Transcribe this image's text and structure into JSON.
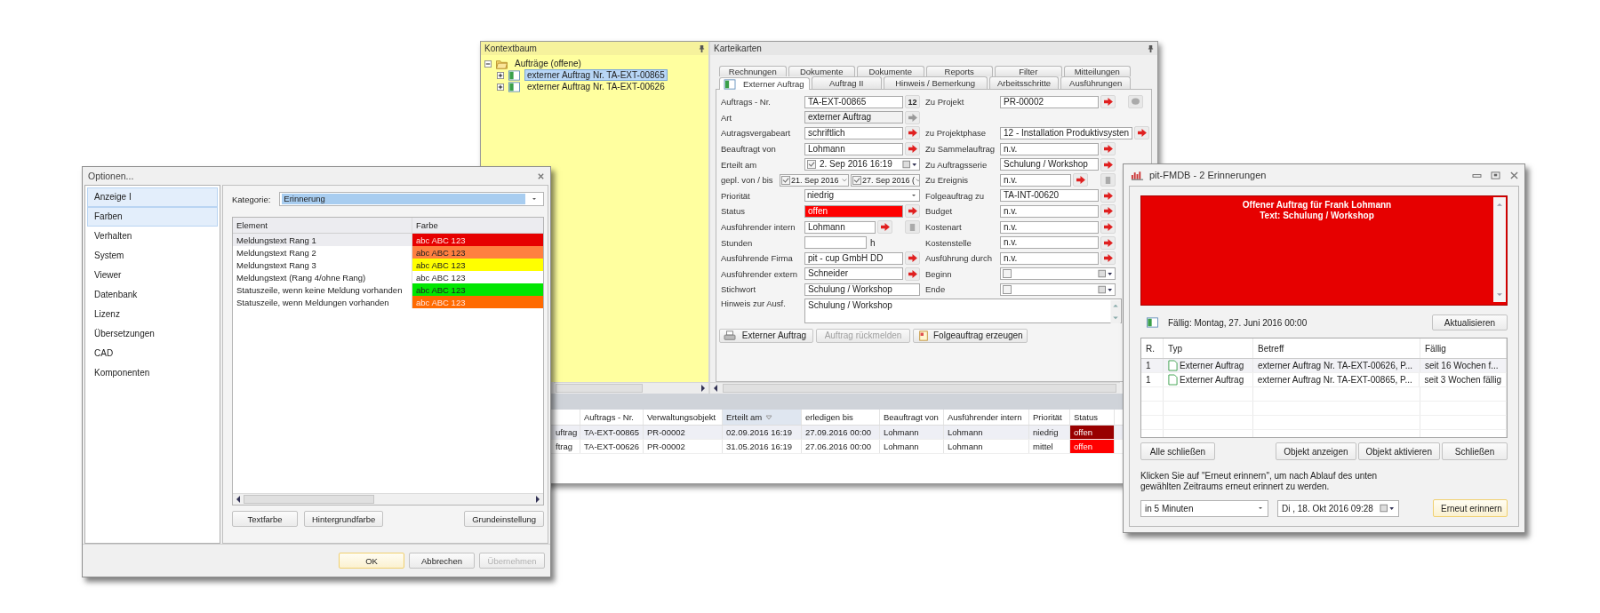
{
  "main_window": {
    "context_tree": {
      "title": "Kontextbaum",
      "items": [
        {
          "label": "Aufträge (offene)",
          "expanded": true,
          "children": [
            {
              "label": "externer Auftrag Nr. TA-EXT-00865",
              "selected": true,
              "expanded": false
            },
            {
              "label": "externer Auftrag Nr. TA-EXT-00626",
              "selected": false,
              "expanded": false
            }
          ]
        }
      ]
    },
    "cards": {
      "title": "Karteikarten",
      "tab_rows": [
        [
          {
            "label": "Rechnungen",
            "selected": false
          },
          {
            "label": "Dokumente",
            "selected": false
          },
          {
            "label": "Dokumente",
            "selected": false
          },
          {
            "label": "Reports",
            "selected": false
          },
          {
            "label": "Filter",
            "selected": false
          },
          {
            "label": "Mitteilungen",
            "selected": false
          }
        ],
        [
          {
            "label": "Externer Auftrag",
            "selected": true
          },
          {
            "label": "Auftrag II",
            "selected": false
          },
          {
            "label": "Hinweis / Bemerkung",
            "selected": false
          },
          {
            "label": "Arbeitsschritte",
            "selected": false
          },
          {
            "label": "Ausführungen",
            "selected": false
          }
        ]
      ],
      "fields_left": [
        {
          "label": "Auftrags - Nr.",
          "kind": "code",
          "value": "TA-EXT-00865",
          "button": "12"
        },
        {
          "label": "Art",
          "kind": "readonly",
          "value": "externer Auftrag"
        },
        {
          "label": "Autragsvergabeart",
          "kind": "lookup",
          "value": "schriftlich"
        },
        {
          "label": "Beauftragt von",
          "kind": "lookup",
          "value": "Lohmann"
        },
        {
          "label": "Erteilt am",
          "kind": "date",
          "checked": true,
          "value": "2. Sep 2016 16:19"
        },
        {
          "label": "gepl. von / bis",
          "kind": "range",
          "from": {
            "checked": true,
            "value": "21. Sep 2016"
          },
          "to": {
            "checked": true,
            "value": "27. Sep 2016 ("
          }
        },
        {
          "label": "Priorität",
          "kind": "combo",
          "value": "niedrig"
        },
        {
          "label": "Status",
          "kind": "lookup",
          "value": "offen",
          "color": "#ff0000"
        },
        {
          "label": "Ausführender intern",
          "kind": "lookup_extra",
          "value": "Lohmann"
        },
        {
          "label": "Stunden",
          "kind": "hours",
          "unit": "h"
        },
        {
          "label": "Ausführende Firma",
          "kind": "lookup",
          "value": "pit - cup GmbH DD"
        },
        {
          "label": "Ausführender extern",
          "kind": "lookup",
          "value": "Schneider"
        },
        {
          "label": "Stichwort",
          "kind": "text",
          "value": "Schulung / Workshop"
        }
      ],
      "fields_right": [
        {
          "label": "Zu  Projekt",
          "kind": "project",
          "value": "PR-00002"
        },
        {
          "label": "zu Projektphase",
          "kind": "lookup",
          "value": "12 - Installation Produktivsysten"
        },
        {
          "label": "Zu Sammelauftrag",
          "kind": "lookup",
          "value": "n.v."
        },
        {
          "label": "Zu Auftragsserie",
          "kind": "lookup",
          "value": "Schulung / Workshop"
        },
        {
          "label": "Zu Ereignis",
          "kind": "lookup_extra",
          "value": "n.v."
        },
        {
          "label": "Folgeauftrag zu",
          "kind": "lookup",
          "value": "TA-INT-00620"
        },
        {
          "label": "Budget",
          "kind": "lookup",
          "value": "n.v."
        },
        {
          "label": "Kostenart",
          "kind": "lookup",
          "value": "n.v."
        },
        {
          "label": "Kostenstelle",
          "kind": "lookup",
          "value": "n.v."
        },
        {
          "label": "Ausführung durch",
          "kind": "lookup",
          "value": "n.v."
        },
        {
          "label": "Beginn",
          "kind": "date",
          "checked": false
        },
        {
          "label": "Ende",
          "kind": "date",
          "checked": false
        }
      ],
      "memo": {
        "label": "Hinweis zur Ausf.",
        "value": "Schulung / Workshop"
      },
      "actions": [
        {
          "label": "Externer Auftrag",
          "disabled": false
        },
        {
          "label": "Auftrag rückmelden",
          "disabled": true
        },
        {
          "label": "Folgeauftrag erzeugen",
          "disabled": false
        }
      ]
    },
    "grid": {
      "columns": [
        {
          "label": "Auftrags - Nr.",
          "sorted": false
        },
        {
          "label": "Verwaltungsobjekt",
          "sorted": false
        },
        {
          "label": "Erteilt am",
          "sorted": true
        },
        {
          "label": "erledigen bis",
          "sorted": false
        },
        {
          "label": "Beauftragt von",
          "sorted": false
        },
        {
          "label": "Ausführender intern",
          "sorted": false
        },
        {
          "label": "Priorität",
          "sorted": false
        },
        {
          "label": "Status",
          "sorted": false
        }
      ],
      "rows": [
        {
          "column_1": "uftrag",
          "cells": [
            "TA-EXT-00865",
            "PR-00002",
            "02.09.2016 16:19",
            "27.09.2016 00:00",
            "Lohmann",
            "Lohmann",
            "niedrig",
            "offen"
          ],
          "color": "#990000",
          "selected": true
        },
        {
          "column_1": "ftrag",
          "cells": [
            "TA-EXT-00626",
            "PR-00002",
            "31.05.2016 16:19",
            "27.06.2016 00:00",
            "Lohmann",
            "Lohmann",
            "mittel",
            "offen"
          ],
          "color": "#ff0000",
          "selected": false
        }
      ]
    }
  },
  "options_window": {
    "title": "Optionen...",
    "nav": [
      {
        "label": "Anzeige I",
        "selected": true
      },
      {
        "label": "Farben",
        "selected": true
      },
      {
        "label": "Verhalten",
        "selected": false
      },
      {
        "label": "System",
        "selected": false
      },
      {
        "label": "Viewer",
        "selected": false
      },
      {
        "label": "Datenbank",
        "selected": false
      },
      {
        "label": "Lizenz",
        "selected": false
      },
      {
        "label": "Übersetzungen",
        "selected": false
      },
      {
        "label": "CAD",
        "selected": false
      },
      {
        "label": "Komponenten",
        "selected": false
      }
    ],
    "category": {
      "label": "Kategorie:",
      "value": "Erinnerung"
    },
    "columns": [
      "Element",
      "Farbe"
    ],
    "rows": [
      {
        "element": "Meldungstext Rang 1",
        "sample": "abc ABC 123",
        "color": "#e60000",
        "selected": true
      },
      {
        "element": "Meldungstext Rang 2",
        "sample": "abc ABC 123",
        "color": "#ff7f40",
        "selected": false
      },
      {
        "element": "Meldungstext Rang 3",
        "sample": "abc ABC 123",
        "color": "#ffff00",
        "selected": false
      },
      {
        "element": "Meldungstext (Rang 4/ohne Rang)",
        "sample": "abc ABC 123",
        "color": "#ffffff",
        "selected": false
      },
      {
        "element": "Statuszeile, wenn keine Meldung vorhanden",
        "sample": "abc ABC 123",
        "color": "#00e600",
        "selected": false
      },
      {
        "element": "Statuszeile, wenn Meldungen vorhanden",
        "sample": "abc ABC 123",
        "color": "#ff6a00",
        "selected": false
      }
    ],
    "tools": [
      "Textfarbe",
      "Hintergrundfarbe",
      "Grundeinstellung"
    ],
    "buttons": [
      {
        "label": "OK",
        "default": true,
        "disabled": false
      },
      {
        "label": "Abbrechen",
        "default": false,
        "disabled": false
      },
      {
        "label": "Übernehmen",
        "default": false,
        "disabled": true
      }
    ]
  },
  "reminder_window": {
    "title": "pit-FMDB - 2 Erinnerungen",
    "message": {
      "lines": [
        "Offener Auftrag für Frank Lohmann",
        "Text: Schulung / Workshop"
      ],
      "color": "#e60000"
    },
    "due": "Fällig: Montag, 27. Juni 2016 00:00",
    "refresh": "Aktualisieren",
    "columns": [
      "R.",
      "Typ",
      "Betreff",
      "Fällig"
    ],
    "rows": [
      {
        "cells": [
          "1",
          "Externer Auftrag",
          "externer Auftrag Nr. TA-EXT-00626, P...",
          "seit 16 Wochen f..."
        ],
        "selected": true
      },
      {
        "cells": [
          "1",
          "Externer Auftrag",
          "externer Auftrag Nr. TA-EXT-00865, P...",
          "seit 3 Wochen fällig"
        ],
        "selected": false
      }
    ],
    "close_all": "Alle schließen",
    "buttons": [
      "Objekt anzeigen",
      "Objekt aktivieren",
      "Schließen"
    ],
    "hint": [
      "Klicken Sie auf \"Erneut erinnern\", um nach Ablauf des unten",
      "gewählten Zeitraums erneut erinnert zu werden."
    ],
    "interval": "in 5 Minuten",
    "date": "Di , 18. Okt 2016 09:28",
    "remind": "Erneut erinnern"
  }
}
